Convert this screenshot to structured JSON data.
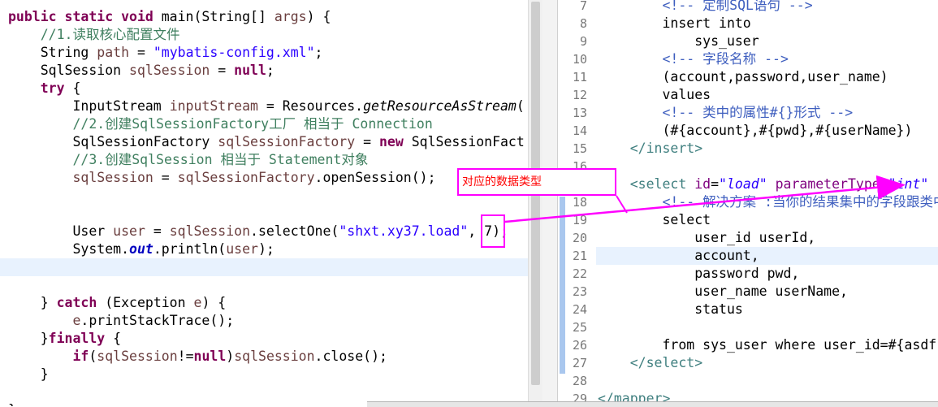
{
  "java_editor": {
    "lines": [
      {
        "parts": [
          {
            "t": "public static void",
            "c": "kw"
          },
          {
            "t": " main(String[] ",
            "c": ""
          },
          {
            "t": "args",
            "c": "var"
          },
          {
            "t": ") {",
            "c": ""
          }
        ]
      },
      {
        "parts": [
          {
            "t": "    //1.读取核心配置文件",
            "c": "cm"
          }
        ]
      },
      {
        "parts": [
          {
            "t": "    String ",
            "c": ""
          },
          {
            "t": "path",
            "c": "var"
          },
          {
            "t": " = ",
            "c": ""
          },
          {
            "t": "\"mybatis-config.xml\"",
            "c": "str"
          },
          {
            "t": ";",
            "c": ""
          }
        ]
      },
      {
        "parts": [
          {
            "t": "    SqlSession ",
            "c": ""
          },
          {
            "t": "sqlSession",
            "c": "var"
          },
          {
            "t": " = ",
            "c": ""
          },
          {
            "t": "null",
            "c": "kw"
          },
          {
            "t": ";",
            "c": ""
          }
        ]
      },
      {
        "parts": [
          {
            "t": "    ",
            "c": ""
          },
          {
            "t": "try",
            "c": "kw"
          },
          {
            "t": " {",
            "c": ""
          }
        ]
      },
      {
        "parts": [
          {
            "t": "        InputStream ",
            "c": ""
          },
          {
            "t": "inputStream",
            "c": "var"
          },
          {
            "t": " = Resources.",
            "c": ""
          },
          {
            "t": "getResourceAsStream",
            "c": "ital"
          },
          {
            "t": "(",
            "c": ""
          }
        ]
      },
      {
        "parts": [
          {
            "t": "        //2.创建SqlSessionFactory工厂 相当于 Connection",
            "c": "cm"
          }
        ]
      },
      {
        "parts": [
          {
            "t": "        SqlSessionFactory ",
            "c": ""
          },
          {
            "t": "sqlSessionFactory",
            "c": "var"
          },
          {
            "t": " = ",
            "c": ""
          },
          {
            "t": "new",
            "c": "kw"
          },
          {
            "t": " SqlSessionFact",
            "c": ""
          }
        ]
      },
      {
        "parts": [
          {
            "t": "        //3.创建SqlSession 相当于 Statement对象",
            "c": "cm"
          }
        ]
      },
      {
        "parts": [
          {
            "t": "        ",
            "c": ""
          },
          {
            "t": "sqlSession",
            "c": "var"
          },
          {
            "t": " = ",
            "c": ""
          },
          {
            "t": "sqlSessionFactory",
            "c": "var"
          },
          {
            "t": ".openSession();",
            "c": ""
          }
        ]
      },
      {
        "parts": []
      },
      {
        "parts": []
      },
      {
        "parts": [
          {
            "t": "        User ",
            "c": ""
          },
          {
            "t": "user",
            "c": "var"
          },
          {
            "t": " = ",
            "c": ""
          },
          {
            "t": "sqlSession",
            "c": "var"
          },
          {
            "t": ".selectOne(",
            "c": ""
          },
          {
            "t": "\"shxt.xy37.load\"",
            "c": "str"
          },
          {
            "t": ", 7);",
            "c": ""
          }
        ]
      },
      {
        "parts": [
          {
            "t": "        System.",
            "c": ""
          },
          {
            "t": "out",
            "c": "fld"
          },
          {
            "t": ".println(",
            "c": ""
          },
          {
            "t": "user",
            "c": "var"
          },
          {
            "t": ");",
            "c": ""
          }
        ]
      },
      {
        "parts": []
      },
      {
        "parts": []
      },
      {
        "parts": [
          {
            "t": "    } ",
            "c": ""
          },
          {
            "t": "catch",
            "c": "kw"
          },
          {
            "t": " (Exception ",
            "c": ""
          },
          {
            "t": "e",
            "c": "var"
          },
          {
            "t": ") {",
            "c": ""
          }
        ]
      },
      {
        "parts": [
          {
            "t": "        ",
            "c": ""
          },
          {
            "t": "e",
            "c": "var"
          },
          {
            "t": ".printStackTrace();",
            "c": ""
          }
        ]
      },
      {
        "parts": [
          {
            "t": "    }",
            "c": ""
          },
          {
            "t": "finally",
            "c": "kw"
          },
          {
            "t": " {",
            "c": ""
          }
        ]
      },
      {
        "parts": [
          {
            "t": "        ",
            "c": ""
          },
          {
            "t": "if",
            "c": "kw"
          },
          {
            "t": "(",
            "c": ""
          },
          {
            "t": "sqlSession",
            "c": "var"
          },
          {
            "t": "!=",
            "c": ""
          },
          {
            "t": "null",
            "c": "kw"
          },
          {
            "t": ")",
            "c": ""
          },
          {
            "t": "sqlSession",
            "c": "var"
          },
          {
            "t": ".close();",
            "c": ""
          }
        ]
      },
      {
        "parts": [
          {
            "t": "    }",
            "c": ""
          }
        ]
      },
      {
        "parts": []
      },
      {
        "parts": [
          {
            "t": "}",
            "c": ""
          }
        ]
      }
    ]
  },
  "xml_editor": {
    "lines": [
      {
        "n": "7",
        "parts": [
          {
            "t": "        <!-- 定制SQL语句 -->",
            "c": "xmlc"
          }
        ]
      },
      {
        "n": "8",
        "parts": [
          {
            "t": "        insert into",
            "c": ""
          }
        ]
      },
      {
        "n": "9",
        "parts": [
          {
            "t": "            sys_user",
            "c": ""
          }
        ]
      },
      {
        "n": "10",
        "parts": [
          {
            "t": "        <!-- 字段名称 -->",
            "c": "xmlc"
          }
        ]
      },
      {
        "n": "11",
        "parts": [
          {
            "t": "        (account,password,user_name)",
            "c": ""
          }
        ]
      },
      {
        "n": "12",
        "parts": [
          {
            "t": "        values",
            "c": ""
          }
        ]
      },
      {
        "n": "13",
        "parts": [
          {
            "t": "        <!-- 类中的属性#{}形式 -->",
            "c": "xmlc"
          }
        ]
      },
      {
        "n": "14",
        "parts": [
          {
            "t": "        (#{account},#{pwd},#{userName})",
            "c": ""
          }
        ]
      },
      {
        "n": "15",
        "parts": [
          {
            "t": "    </insert>",
            "c": "tag"
          }
        ]
      },
      {
        "n": "16",
        "parts": []
      },
      {
        "n": "17",
        "parts": [
          {
            "t": "    <select ",
            "c": "tag"
          },
          {
            "t": "id",
            "c": "attr"
          },
          {
            "t": "=",
            "c": ""
          },
          {
            "t": "\"load\"",
            "c": "aval"
          },
          {
            "t": " ",
            "c": ""
          },
          {
            "t": "parameterType",
            "c": "attr"
          },
          {
            "t": "=",
            "c": ""
          },
          {
            "t": "\"int\"",
            "c": "aval"
          }
        ]
      },
      {
        "n": "18",
        "parts": [
          {
            "t": "        <!-- 解决方案 :当你的结果集中的字段跟类中的",
            "c": "xmlc"
          }
        ]
      },
      {
        "n": "19",
        "parts": [
          {
            "t": "        select",
            "c": ""
          }
        ]
      },
      {
        "n": "20",
        "parts": [
          {
            "t": "            user_id userId,",
            "c": ""
          }
        ]
      },
      {
        "n": "21",
        "parts": [
          {
            "t": "            account,",
            "c": ""
          }
        ]
      },
      {
        "n": "22",
        "parts": [
          {
            "t": "            password pwd,",
            "c": ""
          }
        ]
      },
      {
        "n": "23",
        "parts": [
          {
            "t": "            user_name userName,",
            "c": ""
          }
        ]
      },
      {
        "n": "24",
        "parts": [
          {
            "t": "            status",
            "c": ""
          }
        ]
      },
      {
        "n": "25",
        "parts": []
      },
      {
        "n": "26",
        "parts": [
          {
            "t": "        from sys_user where user_id=#{asdf",
            "c": ""
          }
        ]
      },
      {
        "n": "27",
        "parts": [
          {
            "t": "    </select>",
            "c": "tag"
          }
        ]
      },
      {
        "n": "28",
        "parts": []
      },
      {
        "n": "29",
        "parts": [
          {
            "t": "</mapper>",
            "c": "tag"
          }
        ]
      }
    ]
  },
  "annotation": {
    "label": "对应的数据类型",
    "color": "#ff00ff",
    "text_color": "#ff0000"
  }
}
